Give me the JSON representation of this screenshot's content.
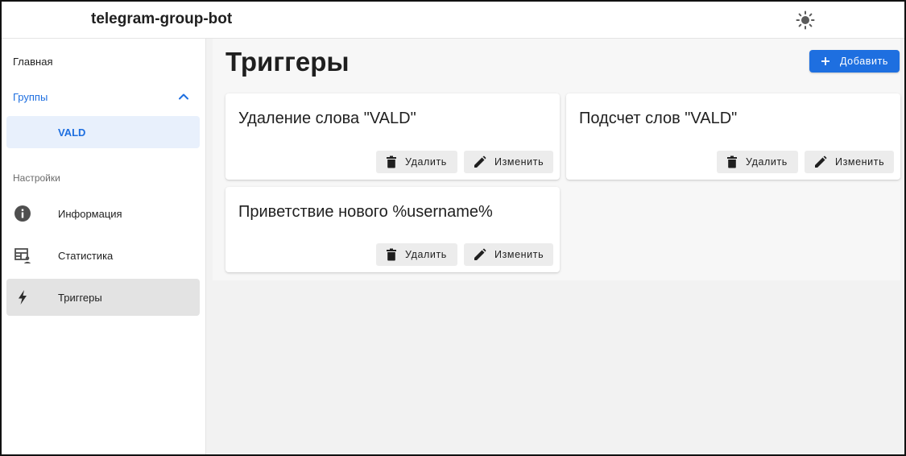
{
  "header": {
    "app_title": "telegram-group-bot",
    "theme_icon": "sun-icon"
  },
  "sidebar": {
    "home_label": "Главная",
    "groups_label": "Группы",
    "groups_expanded": true,
    "group_items": [
      {
        "label": "VALD",
        "selected": true
      }
    ],
    "settings_section_title": "Настройки",
    "settings_items": [
      {
        "label": "Информация",
        "icon": "info-icon"
      },
      {
        "label": "Статистика",
        "icon": "table-user-icon"
      },
      {
        "label": "Триггеры",
        "icon": "lightning-icon",
        "selected": true
      }
    ]
  },
  "main": {
    "page_title": "Триггеры",
    "add_button_label": "Добавить",
    "triggers": [
      {
        "title": "Удаление слова \"VALD\"",
        "delete_label": "Удалить",
        "edit_label": "Изменить"
      },
      {
        "title": "Подсчет слов \"VALD\"",
        "delete_label": "Удалить",
        "edit_label": "Изменить"
      },
      {
        "title": "Приветствие нового %username%",
        "delete_label": "Удалить",
        "edit_label": "Изменить"
      }
    ]
  },
  "colors": {
    "accent": "#1e6fe0",
    "selected_group_bg": "#e8f0fc",
    "selected_nav_bg": "#e3e3e3",
    "main_bg": "#f2f2f2"
  }
}
